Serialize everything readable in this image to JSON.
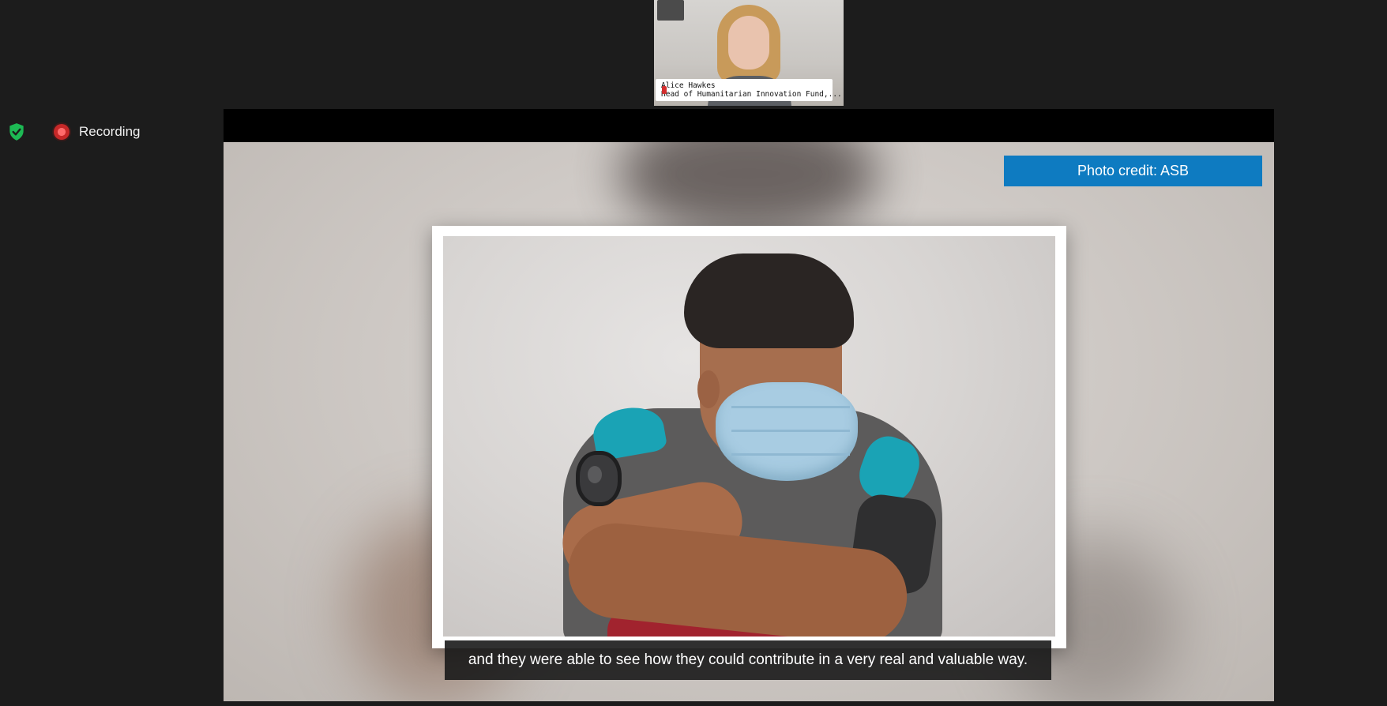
{
  "status": {
    "shield_icon": "shield-check-icon",
    "recording_icon": "recording-dot-icon",
    "recording_label": "Recording",
    "colors": {
      "shield": "#1db954",
      "recording_dot": "#e53935"
    }
  },
  "participant": {
    "name": "Alice Hawkes",
    "title": "Head of Humanitarian Innovation Fund,..."
  },
  "shared_screen": {
    "photo_credit": "Photo credit: ASB",
    "caption": "and they were able to see how they could contribute in a very real and valuable way.",
    "colors": {
      "photo_credit_bg": "#0e7bc1",
      "caption_bg": "#191919"
    }
  }
}
